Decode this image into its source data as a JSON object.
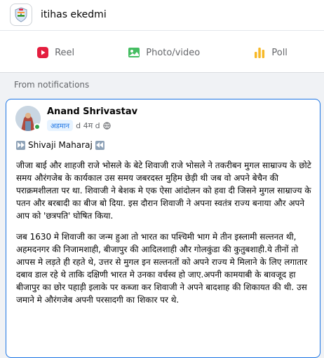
{
  "group": {
    "name": "itihas ekedmi"
  },
  "composer": {
    "reel_label": "Reel",
    "photo_label": "Photo/video",
    "poll_label": "Poll"
  },
  "section": {
    "label": "From notifications"
  },
  "post": {
    "author": "Anand Shrivastav",
    "badge": "अडमान",
    "time": "d 4म d",
    "heading": "Shivaji Maharaj",
    "paragraphs": [
      "जीजा बाई और शाहजी राजे भोसले के बेटे शिवाजी राजे भोसले ने तकरीबन मुगल साम्राज्य के छोटे समय औरंगजेब के कार्यकाल उस समय जबरदस्त मुहिम छेड़ी थी जब वो अपने बेचैन की पराक्रमशीलता पर था. शिवाजी ने बेशक मे एक ऐसा आंदोलन को हवा दी जिसने मुगल साम्राज्य के पतन और बरबादी का बीज बो दिया. इस दौरान शिवाजी ने अपना स्वतंत्र राज्य बनाया और अपने आप को 'छत्रपति' घोषित किया.",
      "जब 1630 मे शिवाजी का जन्म हुआ तो भारत का पश्चिमी भाग मे तीन इस्लामी सल्तनत थी, अहमदनगर की निजामशाही, बीजापुर की आदिलशाही और गोलकुंडा की कुतुबशाही.ये तीनों तो आपस मे लड़ते ही रहते थे, उत्तर से मुगल इन सल्तनतों को अपने राज्य मे मिलाने के लिए लगातार दबाव डाल रहे थे ताकि दक्षिणी भारत मे उनका वर्चस्व हो जाए.अपनी कामयाबी के बावजूद हा बीजापुर का छोर पहाड़ी इलाके पर कब्जा कर शिवाजी ने अपने बादशाह की शिकायत की थी. उस जमाने मे औरंगजेब अपनी परसादगी का शिकार पर थे."
    ]
  },
  "colors": {
    "accent": "#1b74e4",
    "reel": "#e41e3f",
    "photo": "#45bd62",
    "poll": "#f7b928",
    "online": "#31a24c"
  },
  "icons": {
    "group_logo": "flag-shield-logo",
    "reel": "reel-icon",
    "photo": "photo-icon",
    "poll": "poll-icon",
    "privacy": "globe-icon",
    "heading_left": "fast-forward-icon",
    "heading_right": "rewind-icon"
  }
}
